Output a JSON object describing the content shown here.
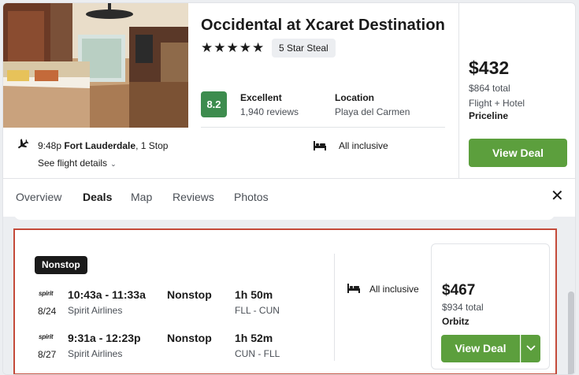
{
  "hotel": {
    "name": "Occidental at Xcaret Destination",
    "stars": "★★★★★",
    "star_badge": "5 Star Steal",
    "score": "8.2",
    "rating_label": "Excellent",
    "reviews": "1,940 reviews",
    "location_label": "Location",
    "location": "Playa del Carmen"
  },
  "top_deal": {
    "price": "$432",
    "total": "$864 total",
    "type": "Flight + Hotel",
    "provider": "Priceline",
    "button": "View Deal"
  },
  "flight_summary": {
    "time": "9:48p",
    "origin": "Fort Lauderdale",
    "stops": ", 1 Stop",
    "details_link": "See flight details",
    "meal_plan": "All inclusive"
  },
  "tabs": [
    {
      "label": "Overview"
    },
    {
      "label": "Deals"
    },
    {
      "label": "Map"
    },
    {
      "label": "Reviews"
    },
    {
      "label": "Photos"
    }
  ],
  "active_tab": "Deals",
  "deal": {
    "badge": "Nonstop",
    "flights": [
      {
        "logo": "spirit",
        "date": "8/24",
        "times": "10:43a - 11:33a",
        "airline": "Spirit Airlines",
        "stops": "Nonstop",
        "duration": "1h 50m",
        "route": "FLL - CUN"
      },
      {
        "logo": "spirit",
        "date": "8/27",
        "times": "9:31a - 12:23p",
        "airline": "Spirit Airlines",
        "stops": "Nonstop",
        "duration": "1h 52m",
        "route": "CUN - FLL"
      }
    ],
    "meal_plan": "All inclusive",
    "price": "$467",
    "total": "$934 total",
    "provider": "Orbitz",
    "button": "View Deal"
  },
  "colors": {
    "green": "#5c9f3d",
    "score_green": "#3d8c4e",
    "highlight_border": "#c44a3a"
  },
  "icons": [
    "plane-icon",
    "bed-icon",
    "chevron-down-icon",
    "close-icon"
  ]
}
